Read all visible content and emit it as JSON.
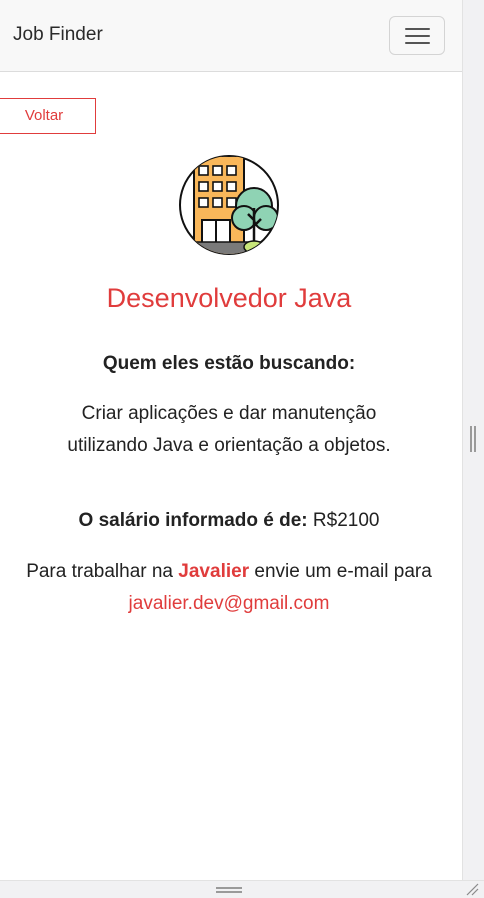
{
  "navbar": {
    "brand": "Job Finder",
    "toggle_icon": "hamburger-menu-icon"
  },
  "actions": {
    "back_label": "Voltar"
  },
  "job": {
    "logo_icon": "company-building-tree-icon",
    "title": "Desenvolvedor Java",
    "looking_for_label": "Quem eles estão buscando:",
    "description": "Criar aplicações e dar manutenção utilizando Java e orientação a objetos.",
    "salary_label": "O salário informado é de:",
    "salary_value": "R$2100",
    "contact_prefix": "Para trabalhar na",
    "company": "Javalier",
    "contact_middle": "envie um e-mail para",
    "email": "javalier.dev@gmail.com"
  },
  "colors": {
    "accent": "#e03c3c",
    "navbar_bg": "#f8f8f8",
    "text": "#222222"
  }
}
